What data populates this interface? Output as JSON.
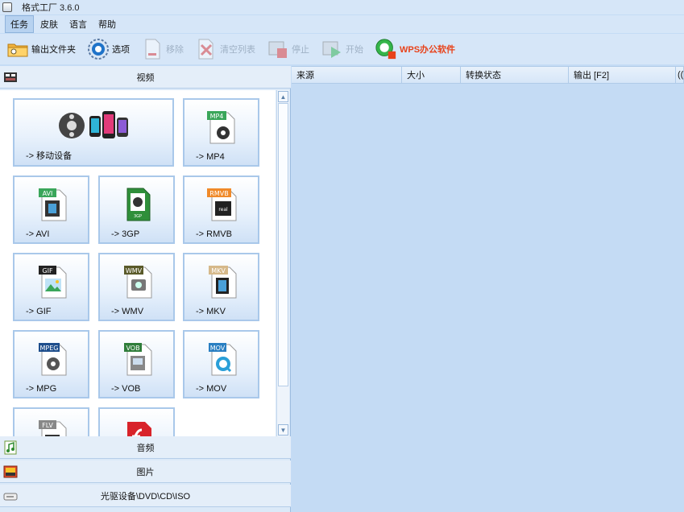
{
  "app": {
    "title": "格式工厂 3.6.0"
  },
  "menubar": [
    {
      "label": "任务",
      "active": true
    },
    {
      "label": "皮肤",
      "active": false
    },
    {
      "label": "语言",
      "active": false
    },
    {
      "label": "帮助",
      "active": false
    }
  ],
  "toolbar": {
    "output_folder": "输出文件夹",
    "options": "选项",
    "remove": "移除",
    "clear_list": "清空列表",
    "stop": "停止",
    "start": "开始",
    "wps": "WPS办公软件"
  },
  "categories": {
    "video": "视频",
    "audio": "音频",
    "image": "图片",
    "disc": "光驱设备\\DVD\\CD\\ISO"
  },
  "tiles": [
    {
      "caption": "-> 移动设备",
      "badge": ""
    },
    {
      "caption": "-> MP4",
      "badge": "MP4"
    },
    {
      "caption": "-> AVI",
      "badge": "AVI"
    },
    {
      "caption": "-> 3GP",
      "badge": "3GP"
    },
    {
      "caption": "-> RMVB",
      "badge": "RMVB"
    },
    {
      "caption": "-> GIF",
      "badge": "GIF"
    },
    {
      "caption": "-> WMV",
      "badge": "WMV"
    },
    {
      "caption": "-> MKV",
      "badge": "MKV"
    },
    {
      "caption": "-> MPG",
      "badge": "MPEG"
    },
    {
      "caption": "-> VOB",
      "badge": "VOB"
    },
    {
      "caption": "-> MOV",
      "badge": "MOV"
    },
    {
      "caption": "",
      "badge": "FLV"
    },
    {
      "caption": "",
      "badge": ""
    }
  ],
  "columns": {
    "source": "来源",
    "size": "大小",
    "status": "转换状态",
    "output": "输出 [F2]",
    "extra": "(("
  },
  "colors": {
    "accent": "#1f73c9",
    "wps_text": "#e8421a",
    "tile_border": "#a9c8ea",
    "list_bg": "#c4dbf4"
  }
}
